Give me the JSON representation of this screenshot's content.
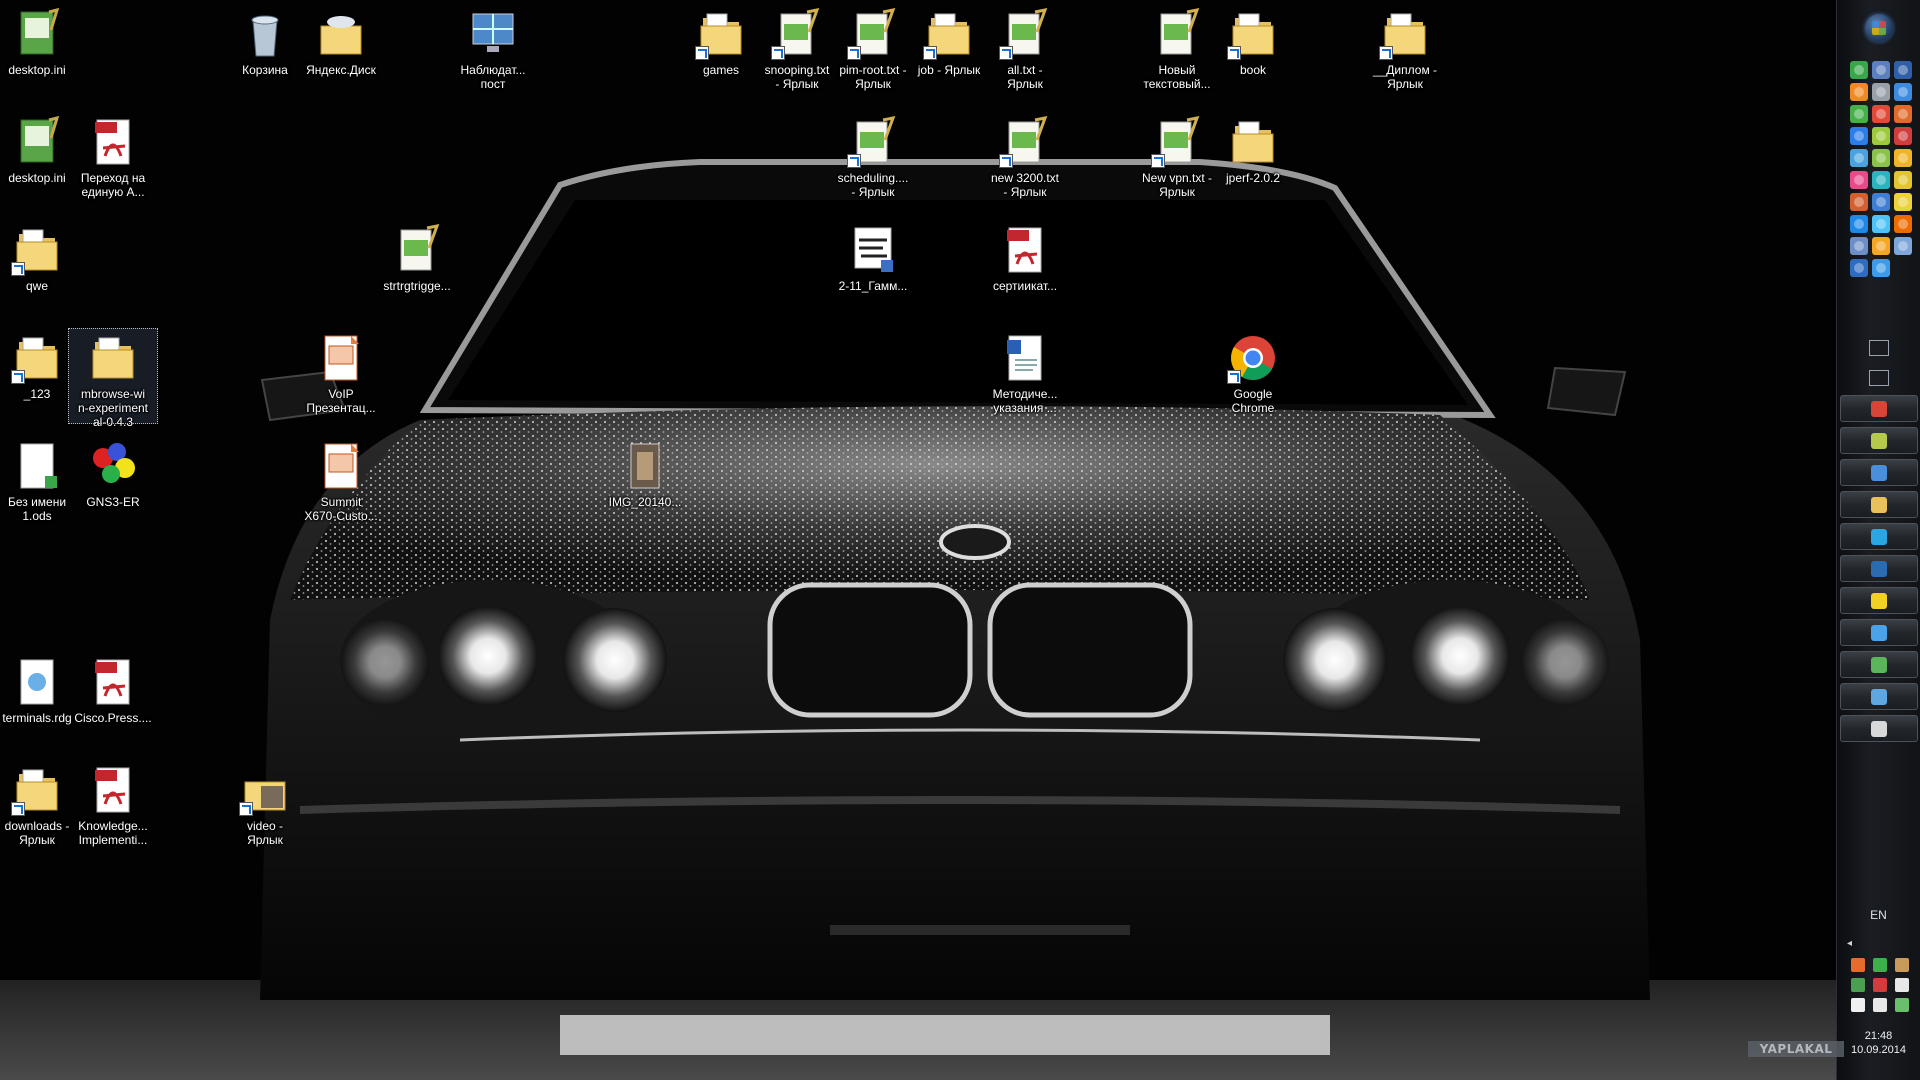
{
  "desktop": {
    "icons": [
      {
        "id": "desktop-ini-1",
        "label": "desktop.ini",
        "kind": "ini"
      },
      {
        "id": "desktop-ini-2",
        "label": "desktop.ini",
        "kind": "ini"
      },
      {
        "id": "qwe",
        "label": "qwe",
        "kind": "folder-shortcut"
      },
      {
        "id": "_123",
        "label": "_123",
        "kind": "folder-shortcut"
      },
      {
        "id": "mbrowse",
        "label": "mbrowse-wi\nn-experiment\nal-0.4.3",
        "kind": "folder"
      },
      {
        "id": "bez-imeni",
        "label": "Без имени\n1.ods",
        "kind": "ods"
      },
      {
        "id": "gns3",
        "label": "GNS3-ER",
        "kind": "gns3"
      },
      {
        "id": "terminals",
        "label": "terminals.rdg",
        "kind": "rdg"
      },
      {
        "id": "cisco-press",
        "label": "Cisco.Press....",
        "kind": "pdf"
      },
      {
        "id": "downloads",
        "label": "downloads -\nЯрлык",
        "kind": "folder-shortcut"
      },
      {
        "id": "knowledge",
        "label": "Knowledge...\nImplementi...",
        "kind": "pdf"
      },
      {
        "id": "perehod",
        "label": "Переход на\nединую А...",
        "kind": "pdf"
      },
      {
        "id": "korzina",
        "label": "Корзина",
        "kind": "recycle"
      },
      {
        "id": "yandex-disk",
        "label": "Яндекс.Диск",
        "kind": "yandex"
      },
      {
        "id": "nabludat",
        "label": "Наблюдат...\nпост",
        "kind": "monitor"
      },
      {
        "id": "strtrgtrigge",
        "label": "strtrgtrigge...",
        "kind": "notepad"
      },
      {
        "id": "voip",
        "label": "VoIP\nПрезентац...",
        "kind": "ppt"
      },
      {
        "id": "summit",
        "label": "Summit\nX670-Custo...",
        "kind": "ppt"
      },
      {
        "id": "video",
        "label": "video -\nЯрлык",
        "kind": "video-shortcut"
      },
      {
        "id": "img-2014",
        "label": "IMG_20140...",
        "kind": "photo"
      },
      {
        "id": "games",
        "label": "games",
        "kind": "folder-shortcut"
      },
      {
        "id": "snooping",
        "label": "snooping.txt\n- Ярлык",
        "kind": "notepad-shortcut"
      },
      {
        "id": "pim-root",
        "label": "pim-root.txt -\nЯрлык",
        "kind": "notepad-shortcut"
      },
      {
        "id": "job",
        "label": "job - Ярлык",
        "kind": "folder-shortcut"
      },
      {
        "id": "all-txt",
        "label": "all.txt -\nЯрлык",
        "kind": "notepad-shortcut"
      },
      {
        "id": "novyi",
        "label": "Новый\nтекстовый...",
        "kind": "notepad"
      },
      {
        "id": "book",
        "label": "book",
        "kind": "folder-shortcut"
      },
      {
        "id": "diplom",
        "label": "__Диплом -\nЯрлык",
        "kind": "folder-shortcut"
      },
      {
        "id": "scheduling",
        "label": "scheduling....\n- Ярлык",
        "kind": "notepad-shortcut"
      },
      {
        "id": "new3200",
        "label": "new 3200.txt\n- Ярлык",
        "kind": "notepad-shortcut"
      },
      {
        "id": "new-vpn",
        "label": "New vpn.txt -\nЯрлык",
        "kind": "notepad-shortcut"
      },
      {
        "id": "jperf",
        "label": "jperf-2.0.2",
        "kind": "folder"
      },
      {
        "id": "gamm",
        "label": "2-11_Гамм...",
        "kind": "visio"
      },
      {
        "id": "sertifikat",
        "label": "сертиикат...",
        "kind": "pdf"
      },
      {
        "id": "metodich",
        "label": "Методиче...\nуказания ...",
        "kind": "word"
      },
      {
        "id": "chrome",
        "label": "Google\nChrome",
        "kind": "chrome-shortcut"
      }
    ]
  },
  "taskbar": {
    "language": "EN",
    "clock_time": "21:48",
    "clock_date": "10.09.2014",
    "tray_expand_glyph": "◂",
    "watermark": "YAPLAKAL",
    "quick_launch_colors": [
      "#3aa64a",
      "#5b7fbf",
      "#2f5fa8",
      "#f08a24",
      "#9aa0a8",
      "#3b8be0",
      "#46b04b",
      "#e04a3a",
      "#e06b2a",
      "#2b7de9",
      "#9fc93c",
      "#cf3d3d",
      "#4aa3df",
      "#8bc34a",
      "#f0b429",
      "#e94b8a",
      "#2bb3c0",
      "#e2c531",
      "#d4602f",
      "#3e7fd4",
      "#ecd23b",
      "#1d88e5",
      "#4fc3f7",
      "#ef6c00",
      "#6d8fc7",
      "#f5a623",
      "#7fa6d9",
      "#2d6cc0",
      "#3d9be9"
    ],
    "task_buttons": [
      {
        "name": "chrome",
        "color": "#d64535"
      },
      {
        "name": "notepad",
        "color": "#b6c94b"
      },
      {
        "name": "network",
        "color": "#4a8fdb"
      },
      {
        "name": "explorer",
        "color": "#e8c15a"
      },
      {
        "name": "skype",
        "color": "#2aa7e3"
      },
      {
        "name": "ps-console",
        "color": "#2b6cb0"
      },
      {
        "name": "lightning-yellow",
        "color": "#f2d024"
      },
      {
        "name": "lightning-blue",
        "color": "#4aa3e8"
      },
      {
        "name": "people",
        "color": "#5db55b"
      },
      {
        "name": "remote-desktop",
        "color": "#5fa7e0"
      },
      {
        "name": "gns3",
        "color": "#d8d8d8"
      }
    ],
    "tray_colors": [
      "#e66c2c",
      "#3cb04a",
      "#c99a59",
      "#4aa050",
      "#d33c3c",
      "#e8e8e8",
      "#f0f0f0",
      "#e8e8e8",
      "#6ac06a"
    ]
  }
}
